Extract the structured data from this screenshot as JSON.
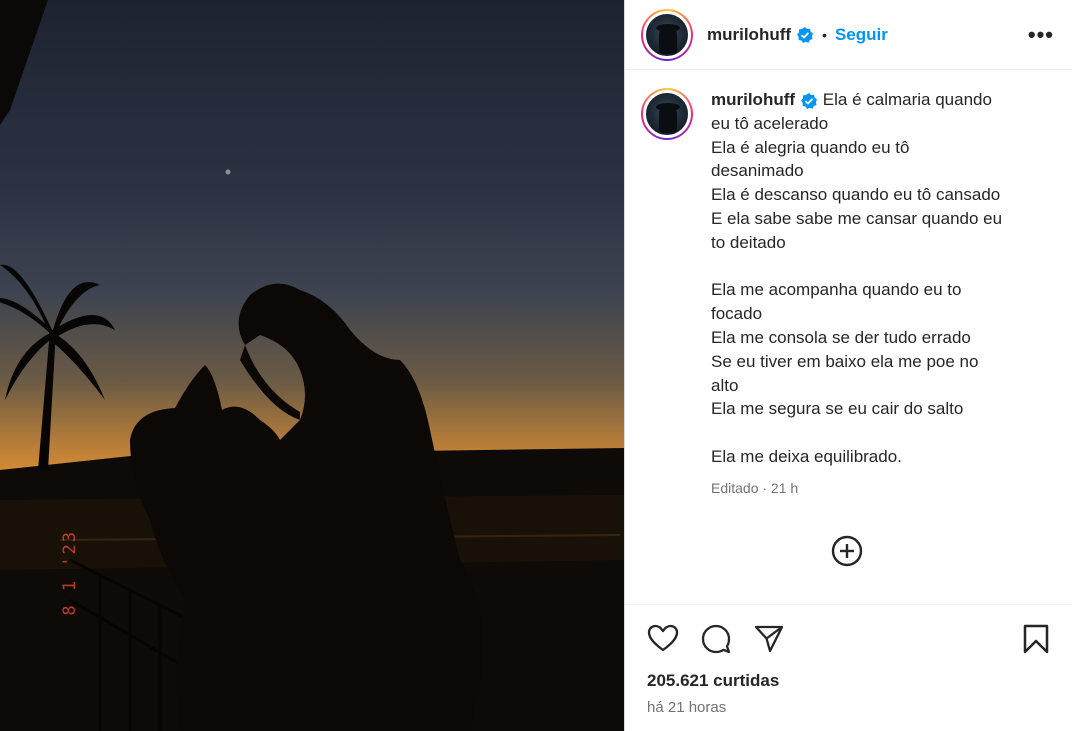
{
  "post": {
    "username": "murilohuff",
    "follow_label": "Seguir",
    "separator": "•",
    "more_label": "•••",
    "caption_lines": [
      "Ela é calmaria quando",
      "eu tô acelerado",
      "Ela é alegria quando eu tô",
      "desanimado",
      "Ela é descanso quando eu tô cansado",
      "E ela sabe sabe me cansar quando eu",
      "to deitado",
      "",
      "Ela me acompanha quando eu to",
      "focado",
      "Ela me consola se der tudo errado",
      "Se eu tiver em baixo ela me poe no",
      "alto",
      "Ela me segura se eu cair do salto",
      "",
      "Ela me deixa equilibrado."
    ],
    "caption_meta": "Editado · 21 h",
    "likes": "205.621 curtidas",
    "posted_ago": "há 21 horas"
  },
  "photo": {
    "date_stamp": "8 1 '23"
  },
  "icons": {
    "verified": "verified-badge-icon",
    "add_comment": "add-circle-icon",
    "like": "heart-icon",
    "comment": "comment-icon",
    "share": "send-icon",
    "save": "bookmark-icon"
  },
  "colors": {
    "accent": "#0095f6",
    "text": "#262626",
    "muted": "#737373",
    "date_stamp": "#e0422b"
  }
}
